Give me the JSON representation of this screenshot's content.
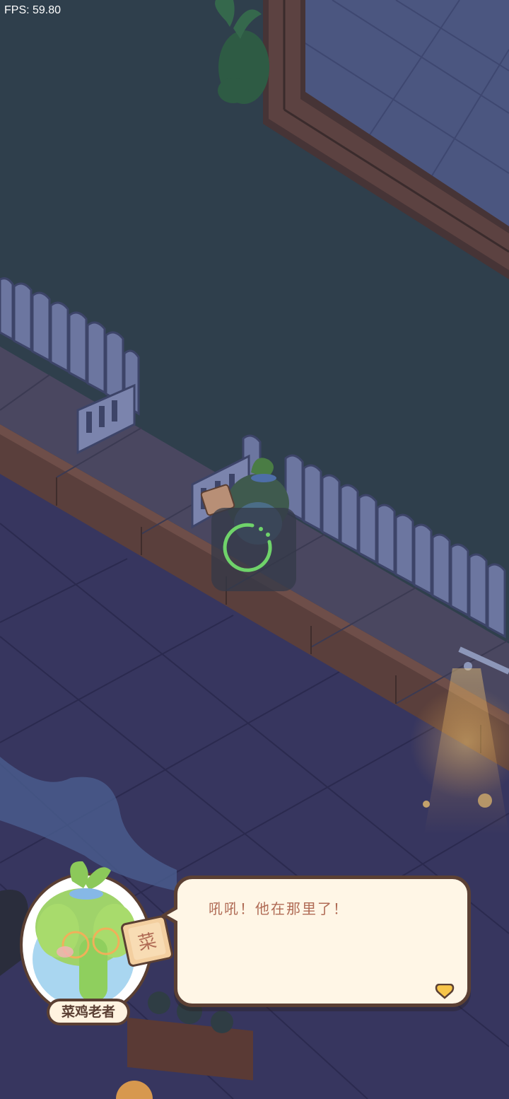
{
  "hud": {
    "fps_label": "FPS: 59.80"
  },
  "npc": {
    "name": "菜鸡老者",
    "book_glyph": "菜"
  },
  "dialog": {
    "text": "吼吼！他在那里了！",
    "next_icon": "heart-arrow-icon"
  },
  "loading": {
    "icon": "loading-spinner-icon",
    "color": "#6fd36a"
  },
  "colors": {
    "floor_dark": "#2e3e4b",
    "fence": "#6f7aa2",
    "dialog_bg": "#fff6e6",
    "dialog_border": "#5b4034",
    "dialog_text": "#b06b55",
    "accent_yellow": "#f7c54a"
  }
}
